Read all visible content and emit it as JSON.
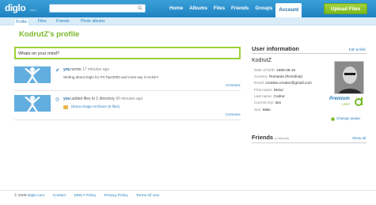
{
  "header": {
    "logo": "diglo",
    "logo_sub": ".com",
    "search_placeholder": "",
    "nav": [
      "Home",
      "Albums",
      "Files",
      "Friends",
      "Groups",
      "Account"
    ],
    "upload_label": "Upload Files"
  },
  "subnav": [
    "Profile",
    "Files",
    "Friends",
    "Photo albums"
  ],
  "page_title": "KodrutZ's profile",
  "status": {
    "value": "Whats on your mind?"
  },
  "feed": [
    {
      "actor": "you",
      "verb": "wrote",
      "time": "17 minutes ago",
      "text": "Writing about Diglo for PCTips3000 and must say it rocks!!!",
      "comment": "Comment"
    },
    {
      "actor": "you",
      "verb": "added files to 1 directory",
      "time": "40 minutes ago",
      "directory": "Diana Image Archives (5 files)",
      "comment": "Comment"
    }
  ],
  "user_info": {
    "heading": "User information",
    "edit_label": "Edit profile",
    "username": "KodrutZ",
    "rows": [
      {
        "label": "Date of birth:",
        "value": "1980-06-16"
      },
      {
        "label": "Country:",
        "value": "Romania (România)"
      },
      {
        "label": "Email:",
        "value": "creative.creator@gmail.com"
      },
      {
        "label": "First name:",
        "value": "Nistor"
      },
      {
        "label": "Last name:",
        "value": "Codrut"
      },
      {
        "label": "Current city:",
        "value": "Iasi"
      },
      {
        "label": "Sex:",
        "value": "Male"
      }
    ],
    "premium": "Premium",
    "premium_sub": "USER",
    "change_avatar": "Change avatar"
  },
  "friends": {
    "heading": "Friends",
    "count": "(0 friends)",
    "show_all": "Show all"
  },
  "footer": {
    "copyright": "© 2009",
    "brand": "Diglo.com",
    "links": [
      "Contact",
      "DMCA Policy",
      "Privacy Policy",
      "Terms Of Use"
    ]
  },
  "colors": {
    "header_blue": "#1f82c1",
    "accent_green": "#7ab828",
    "link_blue": "#2a80bd"
  }
}
